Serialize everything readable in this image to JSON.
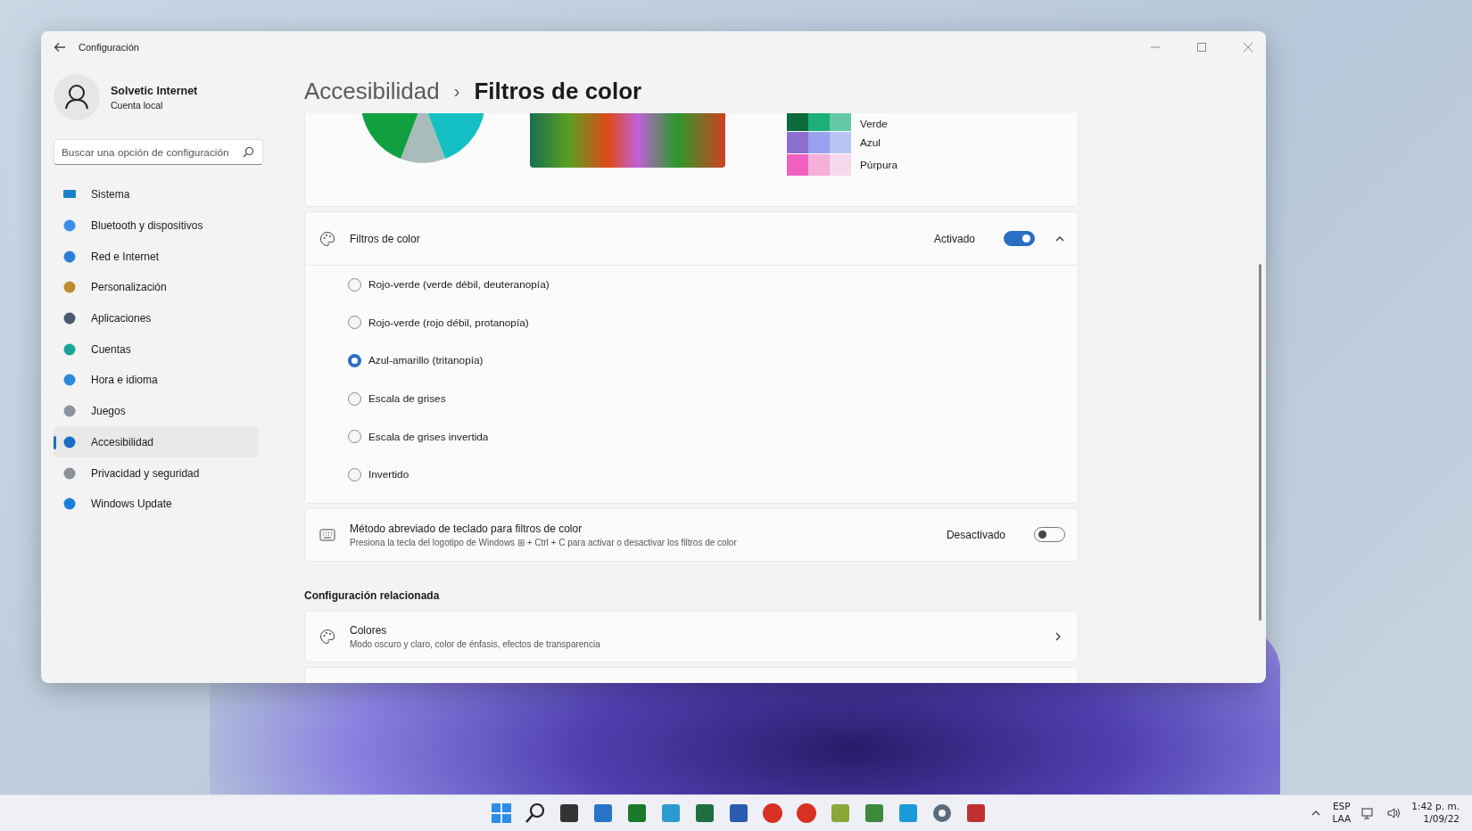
{
  "window": {
    "title": "Configuración"
  },
  "profile": {
    "name": "Solvetic Internet",
    "account": "Cuenta local"
  },
  "search": {
    "placeholder": "Buscar una opción de configuración"
  },
  "sidebar": {
    "items": [
      {
        "label": "Sistema",
        "selected": false
      },
      {
        "label": "Bluetooth y dispositivos",
        "selected": false
      },
      {
        "label": "Red e Internet",
        "selected": false
      },
      {
        "label": "Personalización",
        "selected": false
      },
      {
        "label": "Aplicaciones",
        "selected": false
      },
      {
        "label": "Cuentas",
        "selected": false
      },
      {
        "label": "Hora e idioma",
        "selected": false
      },
      {
        "label": "Juegos",
        "selected": false
      },
      {
        "label": "Accesibilidad",
        "selected": true
      },
      {
        "label": "Privacidad y seguridad",
        "selected": false
      },
      {
        "label": "Windows Update",
        "selected": false
      }
    ]
  },
  "breadcrumb": {
    "parent": "Accesibilidad",
    "separator": "›",
    "current": "Filtros de color"
  },
  "preview": {
    "swatch_rows": [
      {
        "label": "Verde",
        "swatches": [
          {
            "color": "#0b6b3a"
          },
          {
            "color": "#1bb07a"
          },
          {
            "color": "#63c9a4"
          }
        ]
      },
      {
        "label": "Azul",
        "swatches": [
          {
            "color": "#8a6fd0"
          },
          {
            "color": "#98a0f0"
          },
          {
            "color": "#b8c4f4"
          }
        ]
      },
      {
        "label": "Púrpura",
        "swatches": [
          {
            "color": "#f060c0"
          },
          {
            "color": "#f4b0d8"
          },
          {
            "color": "#f8d8ec"
          }
        ]
      }
    ]
  },
  "color_filters": {
    "label": "Filtros de color",
    "state_label": "Activado",
    "on": true,
    "expanded": true,
    "options": [
      {
        "label": "Rojo-verde (verde débil, deuteranopía)",
        "selected": false
      },
      {
        "label": "Rojo-verde (rojo débil, protanopía)",
        "selected": false
      },
      {
        "label": "Azul-amarillo (tritanopía)",
        "selected": true
      },
      {
        "label": "Escala de grises",
        "selected": false
      },
      {
        "label": "Escala de grises invertida",
        "selected": false
      },
      {
        "label": "Invertido",
        "selected": false
      }
    ]
  },
  "shortcut": {
    "title": "Método abreviado de teclado para filtros de color",
    "description": "Presiona la tecla del logotipo de Windows ⊞ + Ctrl + C para activar o desactivar los filtros de color",
    "state_label": "Desactivado",
    "on": false
  },
  "related": {
    "heading": "Configuración relacionada",
    "items": [
      {
        "title": "Colores",
        "description": "Modo oscuro y claro, color de énfasis, efectos de transparencia"
      }
    ]
  },
  "taskbar": {
    "tray": {
      "language": "ESP",
      "layout": "LAA",
      "time": "1:42 p. m.",
      "date": "1/09/22"
    }
  }
}
